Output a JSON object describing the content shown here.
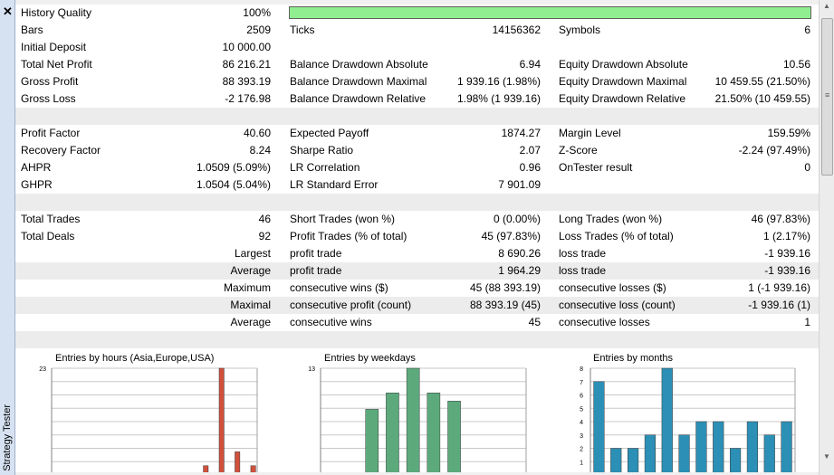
{
  "panel": {
    "side_title": "Strategy Tester"
  },
  "rows": [
    {
      "cls": "",
      "l1": "History Quality",
      "v1": "100%",
      "quality_bar": {
        "fraction": 1.0,
        "color": "#90ee90"
      }
    },
    {
      "cls": "",
      "l1": "Bars",
      "v1": "2509",
      "l2": "Ticks",
      "v2": "14156362",
      "l3": "Symbols",
      "v3": "6"
    },
    {
      "cls": "",
      "l1": "Initial Deposit",
      "v1": "10 000.00"
    },
    {
      "cls": "",
      "l1": "Total Net Profit",
      "v1": "86 216.21",
      "l2": "Balance Drawdown Absolute",
      "v2": "6.94",
      "l3": "Equity Drawdown Absolute",
      "v3": "10.56"
    },
    {
      "cls": "",
      "l1": "Gross Profit",
      "v1": "88 393.19",
      "l2": "Balance Drawdown Maximal",
      "v2": "1 939.16 (1.98%)",
      "l3": "Equity Drawdown Maximal",
      "v3": "10 459.55 (21.50%)"
    },
    {
      "cls": "",
      "l1": "Gross Loss",
      "v1": "-2 176.98",
      "l2": "Balance Drawdown Relative",
      "v2": "1.98% (1 939.16)",
      "l3": "Equity Drawdown Relative",
      "v3": "21.50% (10 459.55)"
    },
    {
      "cls": "alt"
    },
    {
      "cls": "",
      "l1": "Profit Factor",
      "v1": "40.60",
      "l2": "Expected Payoff",
      "v2": "1874.27",
      "l3": "Margin Level",
      "v3": "159.59%"
    },
    {
      "cls": "",
      "l1": "Recovery Factor",
      "v1": "8.24",
      "l2": "Sharpe Ratio",
      "v2": "2.07",
      "l3": "Z-Score",
      "v3": "-2.24 (97.49%)"
    },
    {
      "cls": "",
      "l1": "AHPR",
      "v1": "1.0509 (5.09%)",
      "l2": "LR Correlation",
      "v2": "0.96",
      "l3": "OnTester result",
      "v3": "0"
    },
    {
      "cls": "",
      "l1": "GHPR",
      "v1": "1.0504 (5.04%)",
      "l2": "LR Standard Error",
      "v2": "7 901.09"
    },
    {
      "cls": "alt"
    },
    {
      "cls": "",
      "l1": "Total Trades",
      "v1": "46",
      "l2": "Short Trades (won %)",
      "v2": "0 (0.00%)",
      "l3": "Long Trades (won %)",
      "v3": "46 (97.83%)"
    },
    {
      "cls": "",
      "l1": "Total Deals",
      "v1": "92",
      "l2": "Profit Trades (% of total)",
      "v2": "45 (97.83%)",
      "l3": "Loss Trades (% of total)",
      "v3": "1 (2.17%)"
    },
    {
      "cls": "",
      "v1": "Largest",
      "l2": "profit trade",
      "v2": "8 690.26",
      "l3": "loss trade",
      "v3": "-1 939.16"
    },
    {
      "cls": "alt",
      "v1": "Average",
      "l2": "profit trade",
      "v2": "1 964.29",
      "l3": "loss trade",
      "v3": "-1 939.16"
    },
    {
      "cls": "",
      "v1": "Maximum",
      "l2": "consecutive wins ($)",
      "v2": "45 (88 393.19)",
      "l3": "consecutive losses ($)",
      "v3": "1 (-1 939.16)"
    },
    {
      "cls": "alt",
      "v1": "Maximal",
      "l2": "consecutive profit (count)",
      "v2": "88 393.19 (45)",
      "l3": "consecutive loss (count)",
      "v3": "-1 939.16 (1)"
    },
    {
      "cls": "",
      "v1": "Average",
      "l2": "consecutive wins",
      "v2": "45",
      "l3": "consecutive losses",
      "v3": "1"
    },
    {
      "cls": "alt"
    }
  ],
  "chart_data": [
    {
      "type": "bar",
      "title": "Entries by hours (Asia,Europe,USA)",
      "color": "#d0503c",
      "y_top_label": "23",
      "ylim": [
        0,
        23
      ],
      "values": [
        0,
        0,
        0,
        0,
        0,
        0,
        0,
        0,
        0,
        0,
        0,
        0,
        0,
        0,
        0,
        0,
        0,
        0,
        0,
        2,
        0,
        23,
        0,
        5,
        0,
        2
      ]
    },
    {
      "type": "bar",
      "title": "Entries by weekdays",
      "color": "#5caa7c",
      "y_top_label": "13",
      "ylim": [
        0,
        13
      ],
      "values": [
        0,
        0,
        8,
        10,
        13,
        10,
        9,
        0,
        0,
        0
      ]
    },
    {
      "type": "bar",
      "title": "Entries by months",
      "color": "#2c8fb5",
      "y_ticks": [
        "1",
        "2",
        "3",
        "4",
        "5",
        "6",
        "7",
        "8"
      ],
      "ylim": [
        0,
        8
      ],
      "values": [
        7,
        2,
        2,
        3,
        8,
        3,
        4,
        4,
        2,
        4,
        3,
        4
      ]
    }
  ]
}
